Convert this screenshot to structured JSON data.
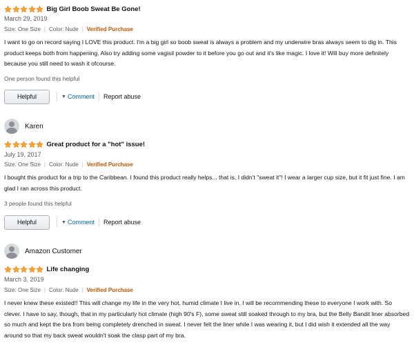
{
  "reviews": [
    {
      "profile_name": "",
      "rating": 5,
      "title": "Big Girl Boob Sweat Be Gone!",
      "date": "March 29, 2019",
      "size": "Size: One Size",
      "color": "Color: Nude",
      "verified": "Verified Purchase",
      "body": "I want to go on record saying I LOVE this product. I'm a big girl so boob sweat is always a problem and my underwire bras always seem to dig in. This product keeps both from happening. Also try adding some vagisil powder to it before you go out and it's like magic. I love it! Will buy more definitely because you still need to wash it ofcourse.",
      "helpful_count": "One person found this helpful",
      "helpful_button": "Helpful",
      "comment_label": "Comment",
      "report_label": "Report abuse"
    },
    {
      "profile_name": "Karen",
      "rating": 5,
      "title": "Great product for a \"hot\" issue!",
      "date": "July 19, 2017",
      "size": "Size: One Size",
      "color": "Color: Nude",
      "verified": "Verified Purchase",
      "body": "I bought this product for a trip to the Caribbean. I found this product really helps... that is, I didn't \"sweat it\"! I wear a larger cup size, but it fit just fine. I am glad I ran across this product.",
      "helpful_count": "3 people found this helpful",
      "helpful_button": "Helpful",
      "comment_label": "Comment",
      "report_label": "Report abuse"
    },
    {
      "profile_name": "Amazon Customer",
      "rating": 5,
      "title": "Life changing",
      "date": "March 3, 2019",
      "size": "Size: One Size",
      "color": "Color: Nude",
      "verified": "Verified Purchase",
      "body": "I never knew these existed!! This will change my life in the very hot, humid climate I live in. I will be recommending these to everyone I work with. So clever. I have to say, though, that in my particularly hot climate (high 90's F), some sweat still soaked through to my bra, but the Belly Bandit liner absorbed so much and kept the bra from being completely drenched in sweat. I never felt the liner while I was wearing it, but I did wish it extended all the way around so that my back sweat wouldn't soak the clasp part of my bra."
    }
  ],
  "colors": {
    "star": "#ffa41c",
    "star_outline": "#de7921",
    "verified": "#c45500",
    "link": "#0066c0"
  }
}
